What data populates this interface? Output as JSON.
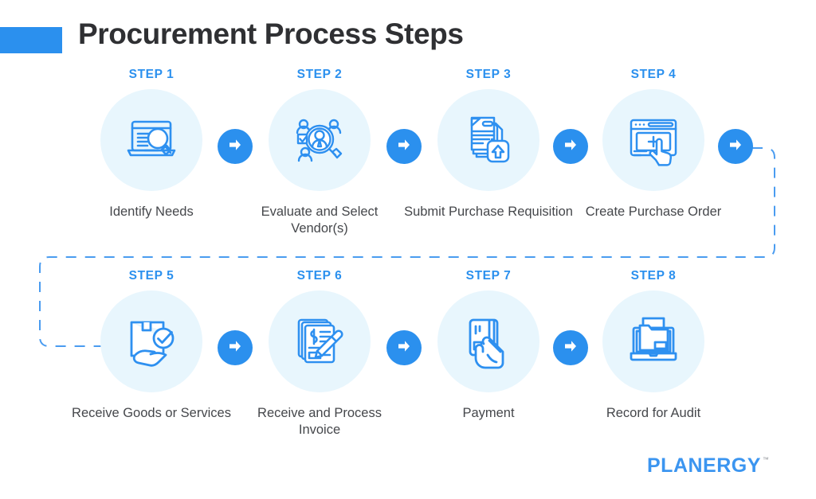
{
  "header": {
    "title": "Procurement Process Steps",
    "accent_color": "#2b90ee"
  },
  "colors": {
    "accent": "#2b90ee",
    "icon_stroke": "#2e90f0",
    "circle_bg": "#e8f6fd",
    "caption": "#45474b",
    "title": "#2f3033",
    "logo_blue": "#3b95f0",
    "logo_orange": "#f58220",
    "connector": "#4a9cf0"
  },
  "rows": [
    {
      "id": "row-1",
      "steps": [
        {
          "step_label": "STEP 1",
          "caption": "Identify Needs",
          "icon": "laptop-magnifier-icon"
        },
        {
          "step_label": "STEP 2",
          "caption": "Evaluate and Select Vendor(s)",
          "icon": "vendor-search-people-icon"
        },
        {
          "step_label": "STEP 3",
          "caption": "Submit Purchase Requisition",
          "icon": "document-upload-icon"
        },
        {
          "step_label": "STEP 4",
          "caption": "Create Purchase Order",
          "icon": "browser-add-click-icon"
        }
      ],
      "arrows": [
        "arrow-right-icon",
        "arrow-right-icon",
        "arrow-right-icon",
        "arrow-right-icon"
      ]
    },
    {
      "id": "row-2",
      "steps": [
        {
          "step_label": "STEP 5",
          "caption": "Receive Goods or Services",
          "icon": "package-delivery-check-icon"
        },
        {
          "step_label": "STEP 6",
          "caption": "Receive and Process Invoice",
          "icon": "invoice-pen-icon"
        },
        {
          "step_label": "STEP 7",
          "caption": "Payment",
          "icon": "hand-credit-card-icon"
        },
        {
          "step_label": "STEP 8",
          "caption": "Record for Audit",
          "icon": "laptop-folder-archive-icon"
        }
      ],
      "arrows": [
        "arrow-right-icon",
        "arrow-right-icon",
        "arrow-right-icon"
      ]
    }
  ],
  "footer": {
    "logo_text": "PLANERGY",
    "logo_trademark": "™"
  }
}
